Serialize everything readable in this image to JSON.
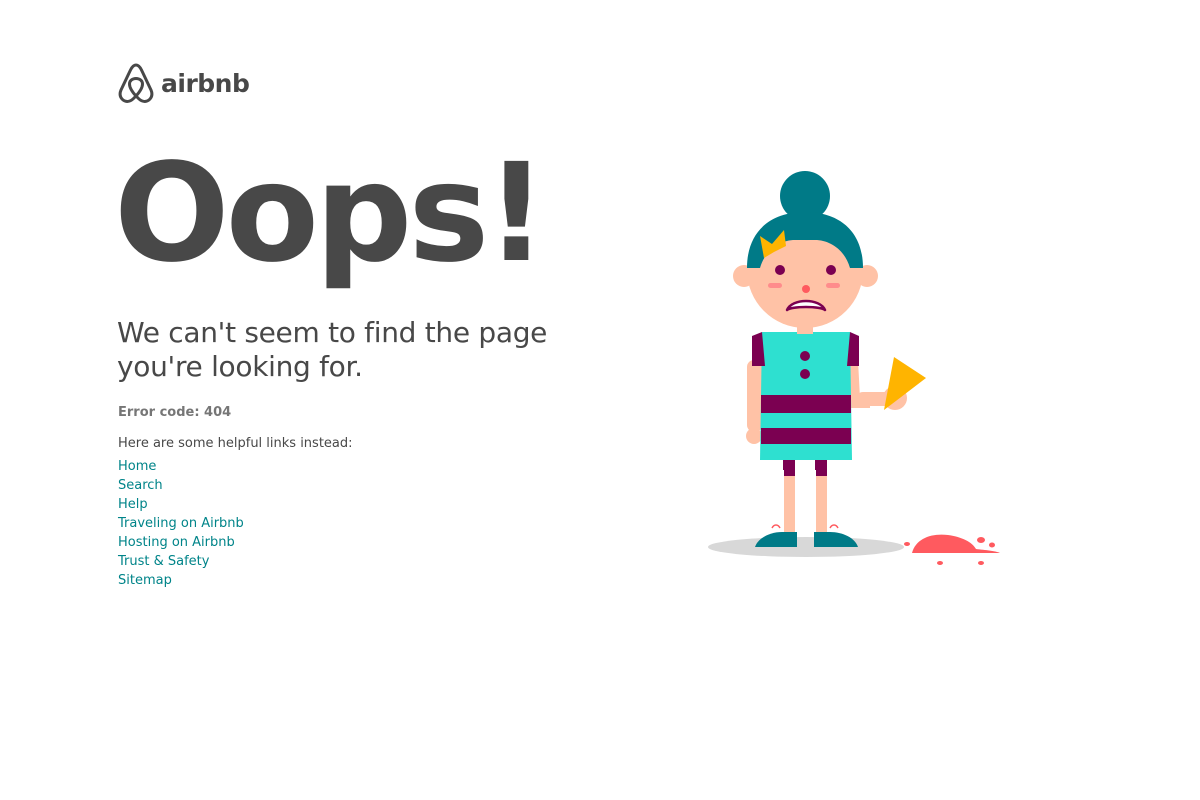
{
  "brand": {
    "name": "airbnb",
    "color": "#484848"
  },
  "page": {
    "headline": "Oops!",
    "subheadline": "We can't seem to find the page you're looking for.",
    "error_code": "Error code: 404",
    "links_intro": "Here are some helpful links instead:"
  },
  "links": [
    {
      "label": "Home"
    },
    {
      "label": "Search"
    },
    {
      "label": "Help"
    },
    {
      "label": "Traveling on Airbnb"
    },
    {
      "label": "Hosting on Airbnb"
    },
    {
      "label": "Trust & Safety"
    },
    {
      "label": "Sitemap"
    }
  ],
  "colors": {
    "text": "#484848",
    "muted": "#767676",
    "link": "#008489",
    "hair": "#007a87",
    "dress": "#2ee0d0",
    "stripes": "#7b0051",
    "skin": "#ffc2a6",
    "ice_cream": "#ff5a5f",
    "cone": "#ffb400"
  },
  "illustration": {
    "subject": "girl-dropped-ice-cream-icon"
  }
}
